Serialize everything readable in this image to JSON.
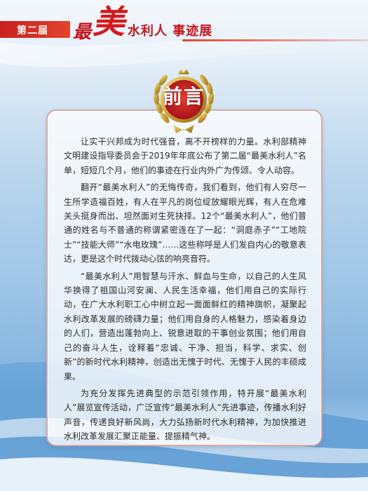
{
  "header": {
    "edition": "第二届",
    "zui": "最",
    "mei": "美",
    "title_rest": "水利人 事迹展"
  },
  "medal": {
    "title": "前言"
  },
  "paragraphs": [
    "让实干兴邦成为时代强音，离不开榜样的力量。水利部精神文明建设指导委员会于2019年年底公布了第二届“最美水利人”名单，短短几个月，他们的事迹在行业内外广为传颂、令人动容。",
    "翻开“最美水利人”的无悔传奇，我们看到，他们有人穷尽一生所学造福百姓，有人在平凡的岗位绽放耀眼光辉，有人在危难关头挺身而出、坦然面对生死抉择。12个“最美水利人”，他们普通的姓名与不普通的称谓紧密连在了一起：“洞庭赤子”“工地院士”“技能大师”“水电玫瑰”……这些称呼是人们发自内心的敬意表达，更是这个时代拨动心弦的响亮音符。",
    "“最美水利人”用智慧与汗水、鲜血与生命，以自己的人生风华换得了祖国山河安澜、人民生活幸福，他们用自己的实际行动，在广大水利职工心中树立起一面面鲜红的精神旗帜，凝聚起水利改革发展的磅礴力量；他们用自身的人格魅力，感染着身边的人们，营造出蓬勃向上、锐意进取的干事创业氛围；他们用自己的奋斗人生，诠释着“忠诚、干净、担当，科学、求实、创新”的新时代水利精神，创造出无愧于时代、无愧于人民的丰硕成果。",
    "为充分发挥先进典型的示范引领作用，特开展“最美水利人”展览宣传活动，广泛宣传“最美水利人”先进事迹，传播水利好声音，传递良好新风尚，大力弘扬新时代水利精神，为加快推进水利改革发展汇聚正能量、提振精气神。"
  ],
  "colors": {
    "accent_red": "#c4161c",
    "gold": "#c9a23a",
    "panel_border": "#d9aaa4"
  }
}
